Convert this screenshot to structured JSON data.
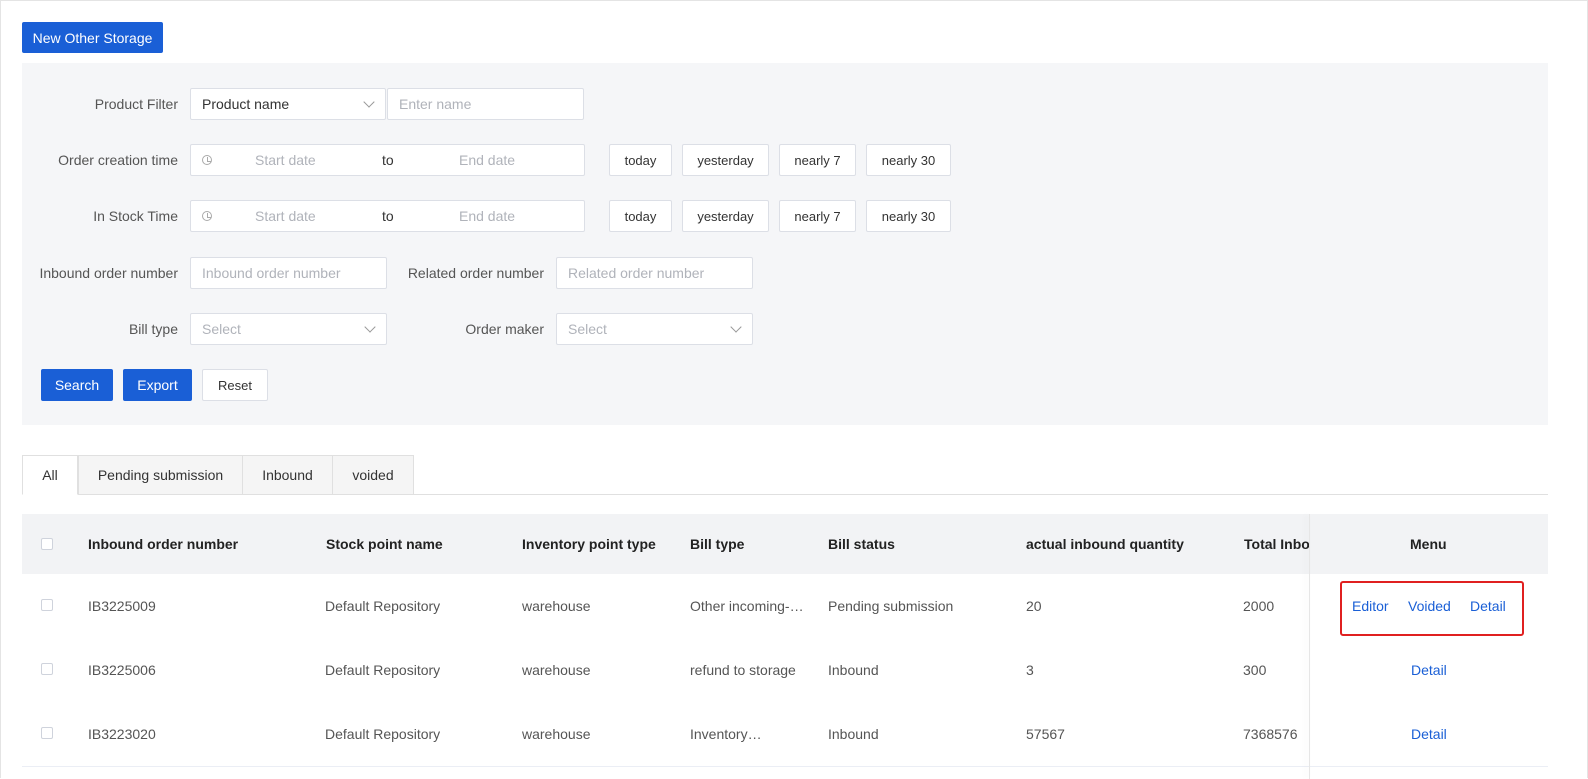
{
  "toolbar": {
    "new_button": "New Other Storage"
  },
  "filters": {
    "product_filter": {
      "label": "Product Filter",
      "select_value": "Product name",
      "placeholder": "Enter name"
    },
    "order_creation": {
      "label": "Order creation time",
      "start": "Start date",
      "to": "to",
      "end": "End date",
      "quick": [
        "today",
        "yesterday",
        "nearly 7",
        "nearly 30"
      ]
    },
    "in_stock": {
      "label": "In Stock Time",
      "start": "Start date",
      "to": "to",
      "end": "End date",
      "quick": [
        "today",
        "yesterday",
        "nearly 7",
        "nearly 30"
      ]
    },
    "inbound_order": {
      "label": "Inbound order number",
      "placeholder": "Inbound order number"
    },
    "related_order": {
      "label": "Related order number",
      "placeholder": "Related order number"
    },
    "bill_type": {
      "label": "Bill type",
      "placeholder": "Select"
    },
    "order_maker": {
      "label": "Order maker",
      "placeholder": "Select"
    },
    "actions": {
      "search": "Search",
      "export": "Export",
      "reset": "Reset"
    }
  },
  "tabs": [
    "All",
    "Pending submission",
    "Inbound",
    "voided"
  ],
  "table": {
    "columns": [
      "Inbound order number",
      "Stock point name",
      "Inventory point type",
      "Bill type",
      "Bill status",
      "actual inbound quantity",
      "Total Inbo",
      "Menu"
    ],
    "rows": [
      {
        "order": "IB3225009",
        "stock_point": "Default Repository",
        "type": "warehouse",
        "bill_type": "Other incoming-…",
        "status": "Pending submission",
        "actual_qty": "20",
        "total": "2000",
        "actions": [
          "Editor",
          "Voided",
          "Detail"
        ]
      },
      {
        "order": "IB3225006",
        "stock_point": "Default Repository",
        "type": "warehouse",
        "bill_type": "refund to storage",
        "status": "Inbound",
        "actual_qty": "3",
        "total": "300",
        "actions": [
          "Detail"
        ]
      },
      {
        "order": "IB3223020",
        "stock_point": "Default Repository",
        "type": "warehouse",
        "bill_type": "Inventory…",
        "status": "Inbound",
        "actual_qty": "57567",
        "total": "7368576",
        "actions": [
          "Detail"
        ]
      }
    ]
  },
  "colors": {
    "primary": "#1a5fd6",
    "highlight": "#e02020"
  }
}
